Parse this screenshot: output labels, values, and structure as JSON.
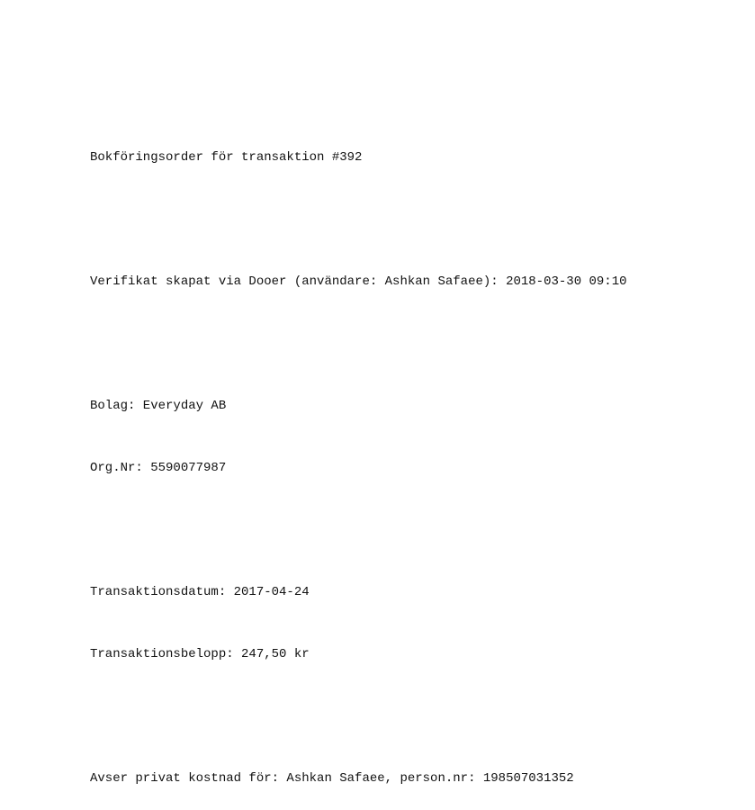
{
  "document": {
    "title": "Bokföringsorder för transaktion #392",
    "verification": "Verifikat skapat via Dooer (användare: Ashkan Safaee): 2018-03-30 09:10",
    "company": "Bolag: Everyday AB",
    "org_nr": "Org.Nr: 5590077987",
    "transaction_date": "Transaktionsdatum: 2017-04-24",
    "transaction_amount": "Transaktionsbelopp: 247,50 kr",
    "private_cost": "Avser privat kostnad för: Ashkan Safaee, person.nr: 198507031352"
  }
}
